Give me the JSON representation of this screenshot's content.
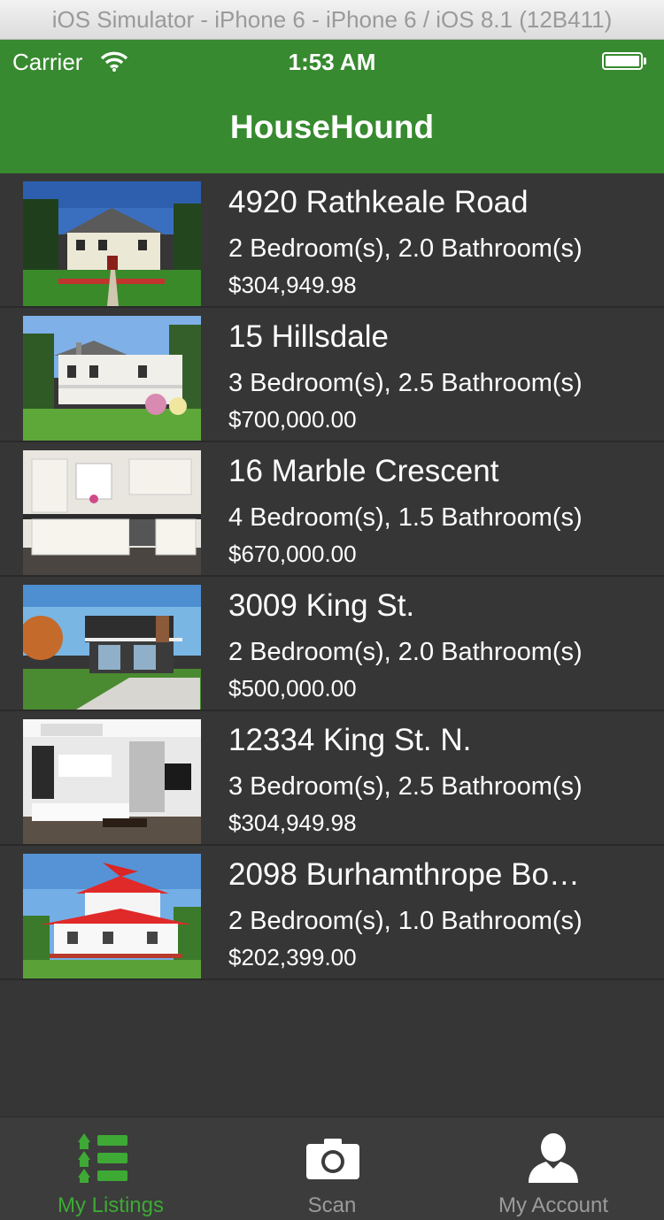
{
  "simulator": {
    "title": "iOS Simulator - iPhone 6 - iPhone 6 / iOS 8.1 (12B411)"
  },
  "status_bar": {
    "carrier": "Carrier",
    "time": "1:53 AM",
    "wifi_icon": "wifi-icon",
    "battery_icon": "battery-icon"
  },
  "nav": {
    "title": "HouseHound"
  },
  "colors": {
    "brand_green": "#378a2f",
    "active_tab": "#3ea935",
    "background": "#363636",
    "tab_bar": "#3c3c3c"
  },
  "listings": [
    {
      "address": "4920 Rathkeale Road",
      "rooms": "2 Bedroom(s), 2.0 Bathroom(s)",
      "price": "$304,949.98",
      "image": "house-photo"
    },
    {
      "address": "15 Hillsdale",
      "rooms": "3 Bedroom(s), 2.5 Bathroom(s)",
      "price": "$700,000.00",
      "image": "farmhouse-photo"
    },
    {
      "address": "16 Marble Crescent",
      "rooms": "4 Bedroom(s), 1.5 Bathroom(s)",
      "price": "$670,000.00",
      "image": "kitchen-photo"
    },
    {
      "address": "3009 King St.",
      "rooms": "2 Bedroom(s), 2.0 Bathroom(s)",
      "price": "$500,000.00",
      "image": "modern-house-photo"
    },
    {
      "address": "12334 King St. N.",
      "rooms": "3 Bedroom(s), 2.5 Bathroom(s)",
      "price": "$304,949.98",
      "image": "living-room-photo"
    },
    {
      "address": "2098 Burhamthrope Bo…",
      "rooms": "2 Bedroom(s), 1.0 Bathroom(s)",
      "price": "$202,399.00",
      "image": "red-roof-house-photo"
    }
  ],
  "tabs": [
    {
      "label": "My Listings",
      "icon": "list-icon",
      "active": true
    },
    {
      "label": "Scan",
      "icon": "camera-icon",
      "active": false
    },
    {
      "label": "My Account",
      "icon": "person-icon",
      "active": false
    }
  ]
}
